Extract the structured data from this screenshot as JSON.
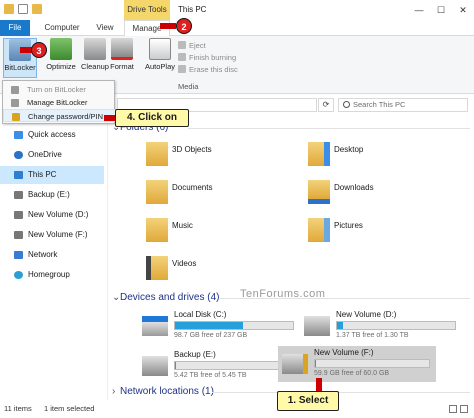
{
  "window": {
    "title": "This PC",
    "contextual_tab": "Drive Tools",
    "minimize_glyph": "—",
    "maximize_glyph": "☐",
    "close_glyph": "✕"
  },
  "ribbon_tabs": {
    "file": "File",
    "computer": "Computer",
    "view": "View",
    "manage": "Manage"
  },
  "ribbon": {
    "bitlocker": "BitLocker",
    "optimize": "Optimize",
    "cleanup": "Cleanup",
    "format": "Format",
    "autoplay": "AutoPlay",
    "eject": "Eject",
    "finish_burning": "Finish burning",
    "erase_disc": "Erase this disc",
    "media_group": "Media"
  },
  "bitlocker_menu": {
    "turn_on": "Turn on BitLocker",
    "manage": "Manage BitLocker",
    "change_pw": "Change password/PIN"
  },
  "address": {
    "search_placeholder": "Search This PC",
    "refresh_glyph": "⟳"
  },
  "nav": {
    "items": [
      {
        "label": "Quick access"
      },
      {
        "label": "OneDrive"
      },
      {
        "label": "This PC"
      },
      {
        "label": "Backup (E:)"
      },
      {
        "label": "New Volume (D:)"
      },
      {
        "label": "New Volume (F:)"
      },
      {
        "label": "Network"
      },
      {
        "label": "Homegroup"
      }
    ]
  },
  "groups": {
    "folders": "Folders (6)",
    "devices": "Devices and drives (4)",
    "network": "Network locations (1)"
  },
  "folders": [
    {
      "label": "3D Objects"
    },
    {
      "label": "Desktop"
    },
    {
      "label": "Documents"
    },
    {
      "label": "Downloads"
    },
    {
      "label": "Music"
    },
    {
      "label": "Pictures"
    },
    {
      "label": "Videos"
    }
  ],
  "drives": [
    {
      "name": "Local Disk (C:)",
      "free": "98.7 GB free of 237 GB",
      "used_fraction": 0.58
    },
    {
      "name": "New Volume (D:)",
      "free": "1.37 TB free of 1.30 TB",
      "used_fraction": 0.05
    },
    {
      "name": "Backup (E:)",
      "free": "5.42 TB free of 5.45 TB",
      "used_fraction": 0.01
    },
    {
      "name": "New Volume (F:)",
      "free": "59.9 GB free of 60.0 GB",
      "used_fraction": 0.01
    }
  ],
  "callouts": {
    "step1": "1. Select",
    "step2": "2",
    "step3": "3",
    "step4": "4. Click on"
  },
  "watermark": "TenForums.com",
  "status": {
    "items": "11 items",
    "selected": "1 item selected"
  },
  "colors": {
    "accent": "#1979ca",
    "drive_tools": "#f5d66b",
    "selection": "#cce8ff",
    "callout_badge": "#e02020",
    "callout_box": "#fff9a8",
    "bar_fill": "#26a0da"
  }
}
